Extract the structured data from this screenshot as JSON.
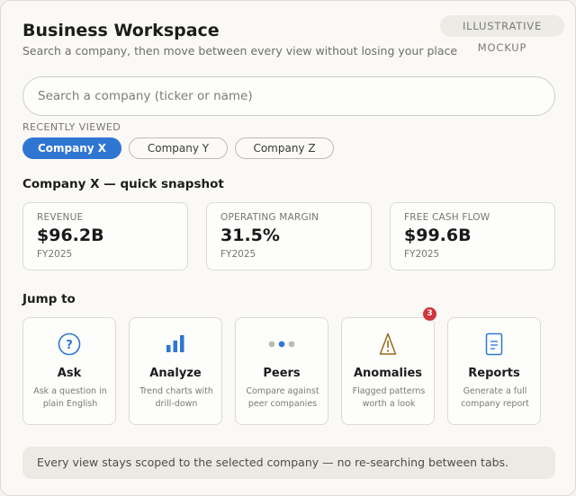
{
  "badge": "ILLUSTRATIVE MOCKUP",
  "header": {
    "title": "Business Workspace",
    "subtitle": "Search a company, then move between every view without losing your place"
  },
  "search": {
    "placeholder": "Search a company (ticker or name)",
    "value": ""
  },
  "recent": {
    "label": "RECENTLY VIEWED",
    "chips": [
      {
        "label": "Company X",
        "active": true
      },
      {
        "label": "Company Y",
        "active": false
      },
      {
        "label": "Company Z",
        "active": false
      }
    ]
  },
  "snapshot": {
    "title": "Company X — quick snapshot",
    "metrics": [
      {
        "label": "REVENUE",
        "value": "$96.2B",
        "period": "FY2025"
      },
      {
        "label": "OPERATING MARGIN",
        "value": "31.5%",
        "period": "FY2025"
      },
      {
        "label": "FREE CASH FLOW",
        "value": "$99.6B",
        "period": "FY2025"
      }
    ]
  },
  "jump": {
    "title": "Jump to",
    "tiles": [
      {
        "label": "Ask",
        "desc": "Ask a question in plain English",
        "icon": "question-icon"
      },
      {
        "label": "Analyze",
        "desc": "Trend charts with drill-down",
        "icon": "bar-chart-icon"
      },
      {
        "label": "Peers",
        "desc": "Compare against peer companies",
        "icon": "dots-icon"
      },
      {
        "label": "Anomalies",
        "desc": "Flagged patterns worth a look",
        "icon": "warning-icon",
        "badge": "3"
      },
      {
        "label": "Reports",
        "desc": "Generate a full company report",
        "icon": "document-icon"
      }
    ]
  },
  "footer": "Every view stays scoped to the selected company — no re-searching between tabs.",
  "colors": {
    "accent": "#2f76d2",
    "warning": "#9a6a1b",
    "badge": "#d0353d"
  }
}
